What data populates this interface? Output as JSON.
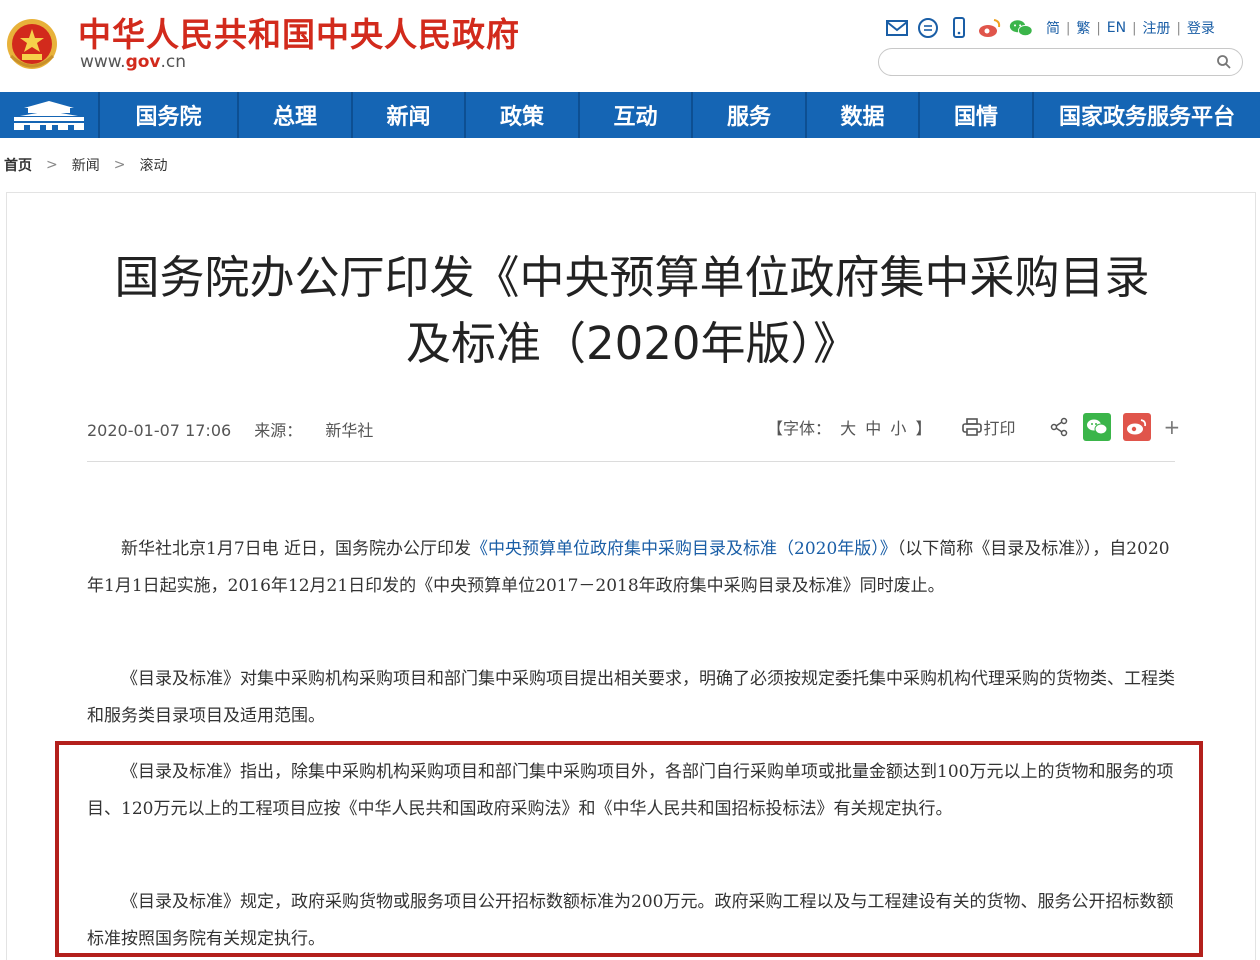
{
  "header": {
    "site_title": "中华人民共和国中央人民政府",
    "site_url_prefix": "www.",
    "site_url_domain": "gov",
    "site_url_suffix": ".cn",
    "tools": {
      "simplified": "简",
      "traditional": "繁",
      "english": "EN",
      "register": "注册",
      "login": "登录",
      "sep": "|"
    },
    "search": {
      "value": "",
      "placeholder": ""
    }
  },
  "nav": {
    "items": [
      "国务院",
      "总理",
      "新闻",
      "政策",
      "互动",
      "服务",
      "数据",
      "国情",
      "国家政务服务平台"
    ]
  },
  "breadcrumb": {
    "home": "首页",
    "level1": "新闻",
    "level2": "滚动",
    "sep": ">"
  },
  "article": {
    "title_line1": "国务院办公厅印发《中央预算单位政府集中采购目录",
    "title_line2": "及标准（2020年版）》",
    "meta": {
      "datetime": "2020-01-07 17:06",
      "source_label": "来源：",
      "source": "新华社",
      "font_open": "【字体：",
      "font_large": "大",
      "font_medium": "中",
      "font_small": "小",
      "font_close": "】",
      "print": "打印",
      "plus": "+"
    },
    "p1_before": "新华社北京1月7日电 近日，国务院办公厅印发",
    "p1_link": "《中央预算单位政府集中采购目录及标准（2020年版）》",
    "p1_after": "（以下简称《目录及标准》），自2020年1月1日起实施，2016年12月21日印发的《中央预算单位2017－2018年政府集中采购目录及标准》同时废止。",
    "p2": "《目录及标准》对集中采购机构采购项目和部门集中采购项目提出相关要求，明确了必须按规定委托集中采购机构代理采购的货物类、工程类和服务类目录项目及适用范围。",
    "p3": "《目录及标准》指出，除集中采购机构采购项目和部门集中采购项目外，各部门自行采购单项或批量金额达到100万元以上的货物和服务的项目、120万元以上的工程项目应按《中华人民共和国政府采购法》和《中华人民共和国招标投标法》有关规定执行。",
    "p4": "《目录及标准》规定，政府采购货物或服务项目公开招标数额标准为200万元。政府采购工程以及与工程建设有关的货物、服务公开招标数额标准按照国务院有关规定执行。"
  },
  "colors": {
    "brand_red": "#d22a1c",
    "nav_blue": "#1565b4",
    "link_blue": "#1a5ea6",
    "highlight_red": "#b3201c"
  }
}
